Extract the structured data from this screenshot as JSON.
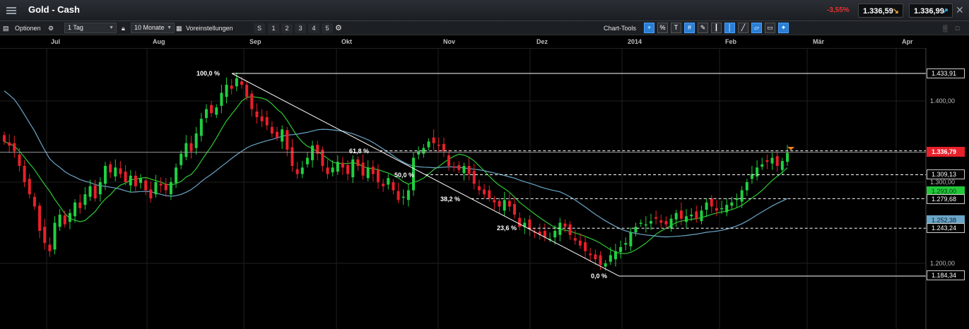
{
  "header": {
    "title": "Gold - Cash",
    "change": "-3,55%",
    "bid": "1.336,59",
    "ask": "1.336,99"
  },
  "toolbar": {
    "options_label": "Optionen",
    "interval": "1 Tag",
    "range": "10 Monate",
    "presets_label": "Voreinstellungen",
    "presets": [
      "S",
      "1",
      "2",
      "3",
      "4",
      "5"
    ],
    "chart_tools_label": "Chart-Tools",
    "tool_icons": [
      "add-indicator-icon",
      "percent-icon",
      "text-tool-icon",
      "grid-icon",
      "draw-tool-icon",
      "candle-icon",
      "bar-chart-icon",
      "line-chart-icon",
      "area-chart-icon",
      "label-icon",
      "settings-blue-icon"
    ]
  },
  "xaxis": {
    "months": [
      "Jul",
      "Aug",
      "Sep",
      "Okt",
      "Nov",
      "Dez",
      "2014",
      "Feb",
      "Mär",
      "Apr"
    ]
  },
  "yaxis": {
    "labels": [
      "1.400,00",
      "1.300,00",
      "1.200,00"
    ]
  },
  "levels": {
    "current_price": "1.336,79",
    "l100": "1.433,91",
    "l618": "1.309,13",
    "l500": "1.279,68",
    "l382": "1.252,38",
    "l236": "1.243,24",
    "l0": "1.184,34",
    "green_tag": "1.293,00"
  },
  "fib_labels": {
    "p100": "100,0 %",
    "p618": "61,8 %",
    "p500": "50,0 %",
    "p382": "38,2 %",
    "p236": "23,6 %",
    "p0": "0,0 %"
  },
  "colors": {
    "up": "#20d040",
    "down": "#e8202a",
    "ma_short": "#2ec832",
    "ma_long": "#6aa6c8",
    "negative": "#e8322f",
    "accent": "#2a7fd4"
  },
  "chart_data": {
    "type": "candlestick",
    "title": "Gold - Cash",
    "ylim": [
      1160,
      1470
    ],
    "fib_high": 1433.91,
    "fib_low": 1184.34,
    "last": 1336.79,
    "candles_close": [
      1350,
      1345,
      1338,
      1320,
      1300,
      1285,
      1270,
      1240,
      1225,
      1215,
      1250,
      1260,
      1248,
      1262,
      1275,
      1268,
      1285,
      1295,
      1280,
      1300,
      1320,
      1312,
      1318,
      1310,
      1300,
      1308,
      1295,
      1305,
      1290,
      1280,
      1300,
      1296,
      1290,
      1300,
      1318,
      1335,
      1348,
      1338,
      1360,
      1378,
      1390,
      1385,
      1392,
      1410,
      1420,
      1415,
      1428,
      1420,
      1405,
      1390,
      1380,
      1375,
      1370,
      1360,
      1355,
      1365,
      1340,
      1320,
      1310,
      1318,
      1330,
      1345,
      1335,
      1320,
      1310,
      1318,
      1325,
      1318,
      1310,
      1328,
      1320,
      1308,
      1318,
      1310,
      1300,
      1295,
      1305,
      1290,
      1278,
      1282,
      1290,
      1330,
      1338,
      1342,
      1350,
      1348,
      1345,
      1338,
      1320,
      1318,
      1315,
      1320,
      1310,
      1298,
      1290,
      1285,
      1280,
      1275,
      1270,
      1278,
      1270,
      1260,
      1245,
      1250,
      1242,
      1238,
      1235,
      1232,
      1230,
      1240,
      1250,
      1245,
      1235,
      1228,
      1222,
      1215,
      1210,
      1205,
      1198,
      1200,
      1210,
      1215,
      1220,
      1225,
      1238,
      1245,
      1250,
      1248,
      1252,
      1255,
      1250,
      1248,
      1255,
      1262,
      1255,
      1258,
      1260,
      1255,
      1265,
      1275,
      1270,
      1265,
      1268,
      1272,
      1275,
      1280,
      1290,
      1300,
      1310,
      1318,
      1322,
      1325,
      1330,
      1320,
      1326,
      1336
    ]
  }
}
